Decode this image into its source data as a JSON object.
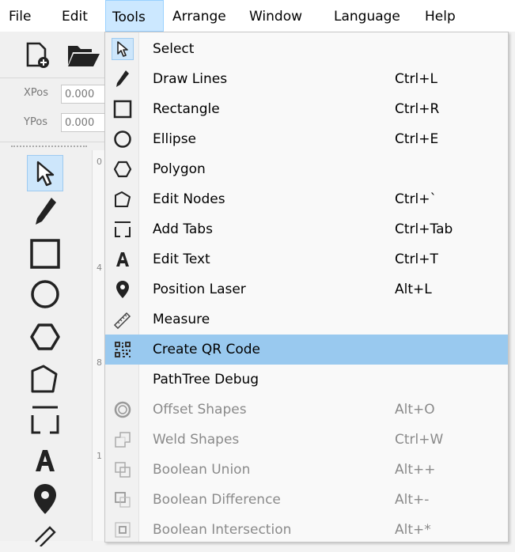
{
  "menubar": [
    "File",
    "Edit",
    "Tools",
    "Arrange",
    "Window",
    "Language",
    "Help"
  ],
  "position": {
    "xpos_label": "XPos",
    "xpos_value": "0.000",
    "ypos_label": "YPos",
    "ypos_value": "0.000"
  },
  "ruler_ticks": [
    "0",
    "4",
    "8",
    "1"
  ],
  "tools_menu": [
    {
      "label": "Select",
      "shortcut": "",
      "icon": "cursor-icon",
      "enabled": true
    },
    {
      "label": "Draw Lines",
      "shortcut": "Ctrl+L",
      "icon": "pen-icon",
      "enabled": true
    },
    {
      "label": "Rectangle",
      "shortcut": "Ctrl+R",
      "icon": "rectangle-icon",
      "enabled": true
    },
    {
      "label": "Ellipse",
      "shortcut": "Ctrl+E",
      "icon": "ellipse-icon",
      "enabled": true
    },
    {
      "label": "Polygon",
      "shortcut": "",
      "icon": "hexagon-icon",
      "enabled": true
    },
    {
      "label": "Edit Nodes",
      "shortcut": "Ctrl+`",
      "icon": "nodes-icon",
      "enabled": true
    },
    {
      "label": "Add Tabs",
      "shortcut": "Ctrl+Tab",
      "icon": "tabs-icon",
      "enabled": true
    },
    {
      "label": "Edit Text",
      "shortcut": "Ctrl+T",
      "icon": "text-icon",
      "enabled": true
    },
    {
      "label": "Position Laser",
      "shortcut": "Alt+L",
      "icon": "location-pin-icon",
      "enabled": true
    },
    {
      "label": "Measure",
      "shortcut": "",
      "icon": "ruler-icon",
      "enabled": true
    },
    {
      "label": "Create QR Code",
      "shortcut": "",
      "icon": "qr-code-icon",
      "enabled": true
    },
    {
      "label": "PathTree Debug",
      "shortcut": "",
      "icon": "",
      "enabled": true
    },
    {
      "label": "Offset Shapes",
      "shortcut": "Alt+O",
      "icon": "offset-icon",
      "enabled": false
    },
    {
      "label": "Weld Shapes",
      "shortcut": "Ctrl+W",
      "icon": "weld-icon",
      "enabled": false
    },
    {
      "label": "Boolean Union",
      "shortcut": "Alt++",
      "icon": "union-icon",
      "enabled": false
    },
    {
      "label": "Boolean Difference",
      "shortcut": "Alt+-",
      "icon": "difference-icon",
      "enabled": false
    },
    {
      "label": "Boolean Intersection",
      "shortcut": "Alt+*",
      "icon": "intersection-icon",
      "enabled": false
    }
  ],
  "highlighted_item": "Create QR Code",
  "colors": {
    "highlight": "#99c9ef",
    "menubar_active": "#cce8ff",
    "tool_selected": "#cde6fb"
  }
}
